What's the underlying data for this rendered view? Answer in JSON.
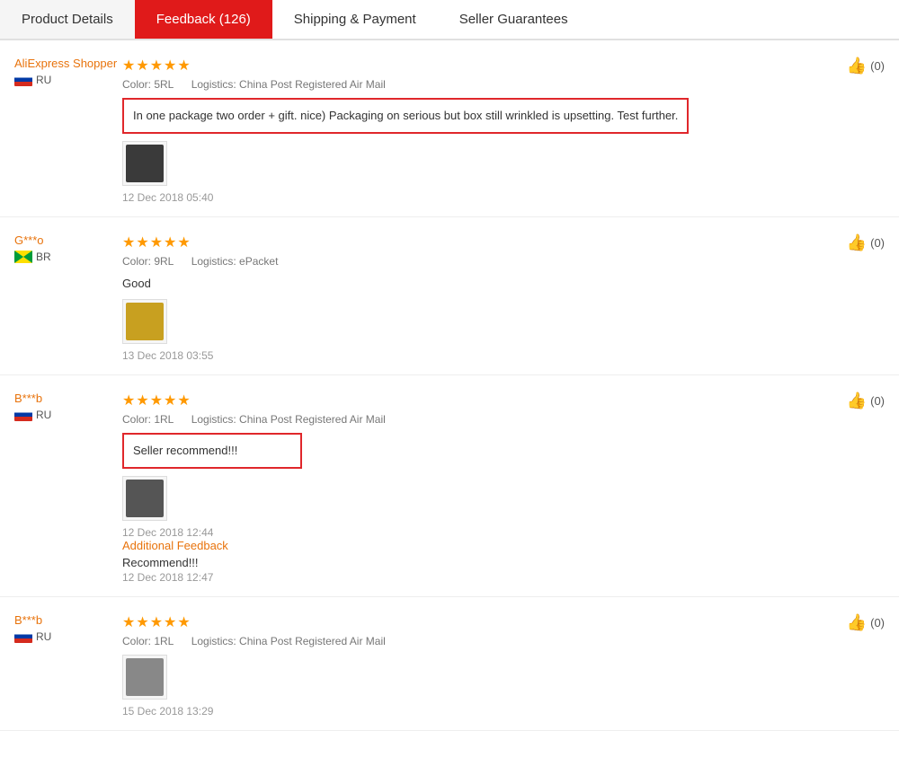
{
  "tabs": [
    {
      "id": "product-details",
      "label": "Product Details",
      "active": false
    },
    {
      "id": "feedback",
      "label": "Feedback (126)",
      "active": true
    },
    {
      "id": "shipping-payment",
      "label": "Shipping & Payment",
      "active": false
    },
    {
      "id": "seller-guarantees",
      "label": "Seller Guarantees",
      "active": false
    }
  ],
  "reviews": [
    {
      "id": "review-1",
      "username": "AliExpress Shopper",
      "country_code": "RU",
      "country_flag": "ru",
      "stars": 5,
      "max_stars": 5,
      "color": "5RL",
      "logistics": "China Post Registered Air Mail",
      "text": "In one package two order + gift. nice) Packaging on serious but box still wrinkled is upsetting. Test further.",
      "text_boxed": true,
      "image_color": "dark",
      "date": "12 Dec 2018 05:40",
      "likes": 0,
      "additional_feedback": null
    },
    {
      "id": "review-2",
      "username": "G***o",
      "country_code": "BR",
      "country_flag": "br",
      "stars": 5,
      "max_stars": 5,
      "color": "9RL",
      "logistics": "ePacket",
      "text": "Good",
      "text_boxed": false,
      "image_color": "yellow",
      "date": "13 Dec 2018 03:55",
      "likes": 0,
      "additional_feedback": null
    },
    {
      "id": "review-3",
      "username": "B***b",
      "country_code": "RU",
      "country_flag": "ru",
      "stars": 5,
      "max_stars": 5,
      "color": "1RL",
      "logistics": "China Post Registered Air Mail",
      "text": "Seller recommend!!!",
      "text_boxed": true,
      "image_color": "darkgray",
      "date": "12 Dec 2018 12:44",
      "likes": 0,
      "additional_feedback": {
        "label": "Additional Feedback",
        "text": "Recommend!!!",
        "date": "12 Dec 2018 12:47"
      }
    },
    {
      "id": "review-4",
      "username": "B***b",
      "country_code": "RU",
      "country_flag": "ru",
      "stars": 5,
      "max_stars": 5,
      "color": "1RL",
      "logistics": "China Post Registered Air Mail",
      "text": null,
      "text_boxed": false,
      "image_color": "gray",
      "date": "15 Dec 2018 13:29",
      "likes": 0,
      "additional_feedback": null
    }
  ],
  "labels": {
    "color_prefix": "Color:",
    "logistics_prefix": "Logistics:",
    "likes_open": "(",
    "likes_close": ")"
  }
}
